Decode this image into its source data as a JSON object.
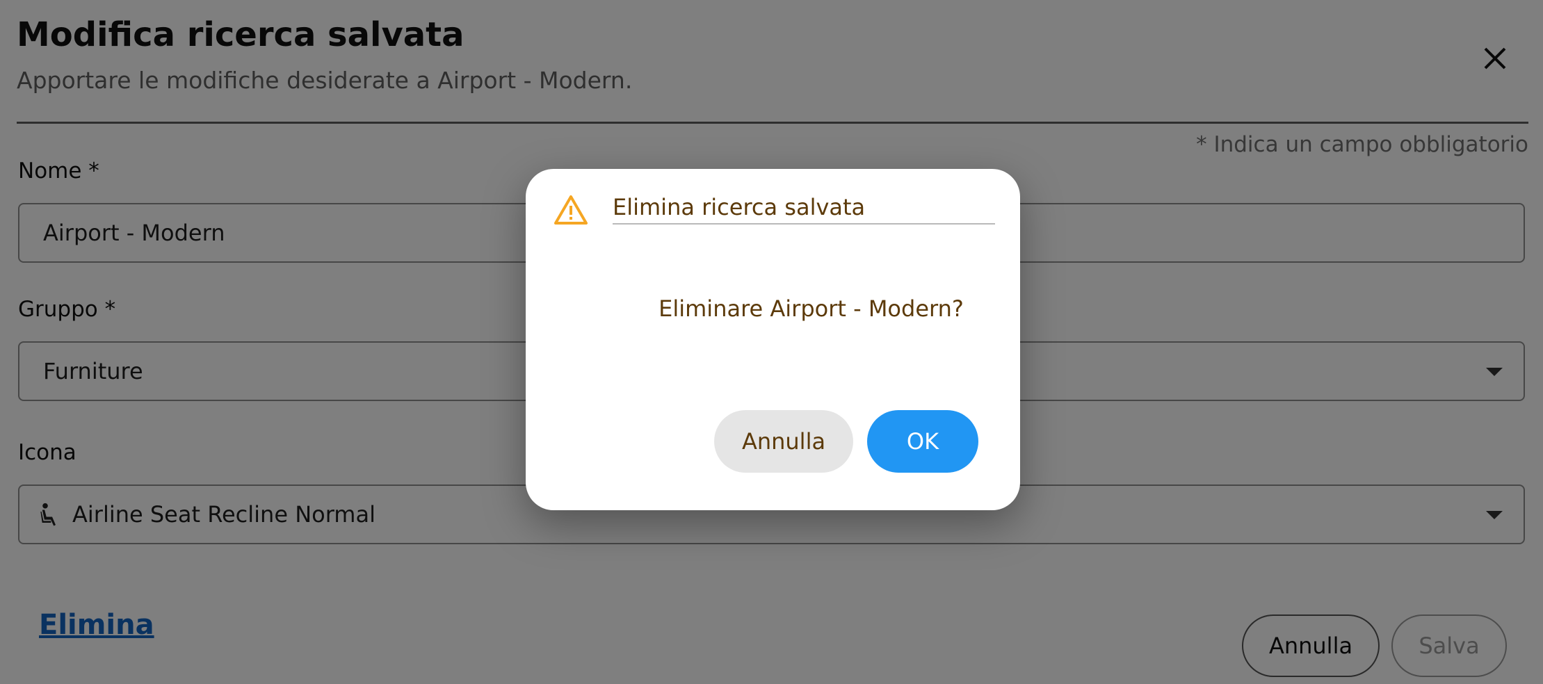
{
  "header": {
    "title": "Modifica ricerca salvata",
    "subtitle": "Apportare le modifiche desiderate a Airport - Modern.",
    "close_icon": "close-icon",
    "required_note": "* Indica un campo obbligatorio"
  },
  "form": {
    "name": {
      "label": "Nome *",
      "value": "Airport - Modern"
    },
    "group": {
      "label": "Gruppo *",
      "value": "Furniture"
    },
    "icon": {
      "label": "Icona",
      "value": "Airline Seat Recline Normal",
      "icon_name": "airline-seat-recline-normal-icon"
    }
  },
  "footer": {
    "delete_label": "Elimina",
    "cancel_label": "Annulla",
    "save_label": "Salva"
  },
  "dialog": {
    "title": "Elimina ricerca salvata",
    "icon": "warning-icon",
    "message": "Eliminare Airport - Modern?",
    "cancel_label": "Annulla",
    "ok_label": "OK"
  },
  "colors": {
    "accent": "#2196f3",
    "link": "#1565c0",
    "warning": "#f5a623",
    "dialog_text": "#5c3a0a"
  }
}
